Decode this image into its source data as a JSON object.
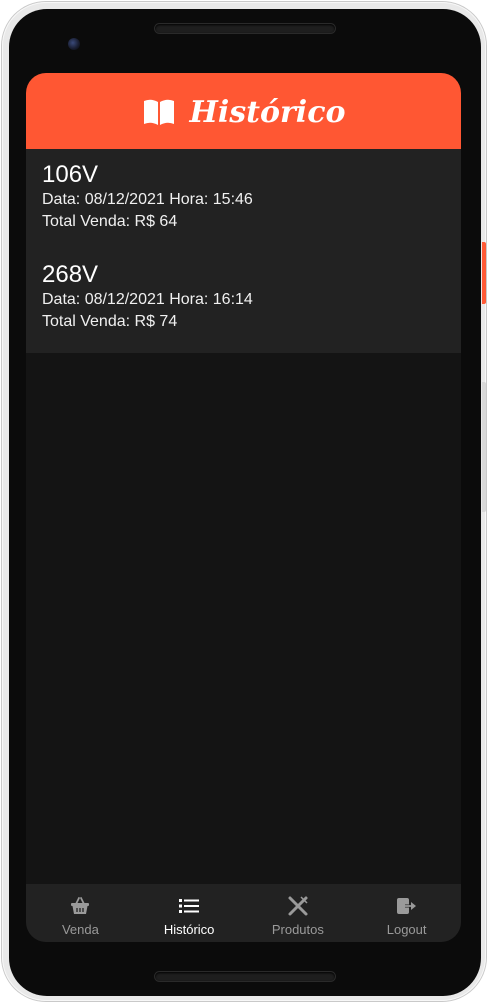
{
  "header": {
    "title": "Histórico",
    "icon": "book-icon",
    "color": "#ff5733"
  },
  "sales": [
    {
      "id": "106V",
      "date_line": "Data: 08/12/2021 Hora: 15:46",
      "total_line": "Total Venda: R$ 64"
    },
    {
      "id": "268V",
      "date_line": "Data: 08/12/2021 Hora: 16:14",
      "total_line": "Total Venda: R$ 74"
    }
  ],
  "nav": {
    "items": [
      {
        "label": "Venda",
        "icon": "basket-icon"
      },
      {
        "label": "Histórico",
        "icon": "list-icon",
        "active": true
      },
      {
        "label": "Produtos",
        "icon": "utensils-icon"
      },
      {
        "label": "Logout",
        "icon": "logout-icon"
      }
    ]
  }
}
